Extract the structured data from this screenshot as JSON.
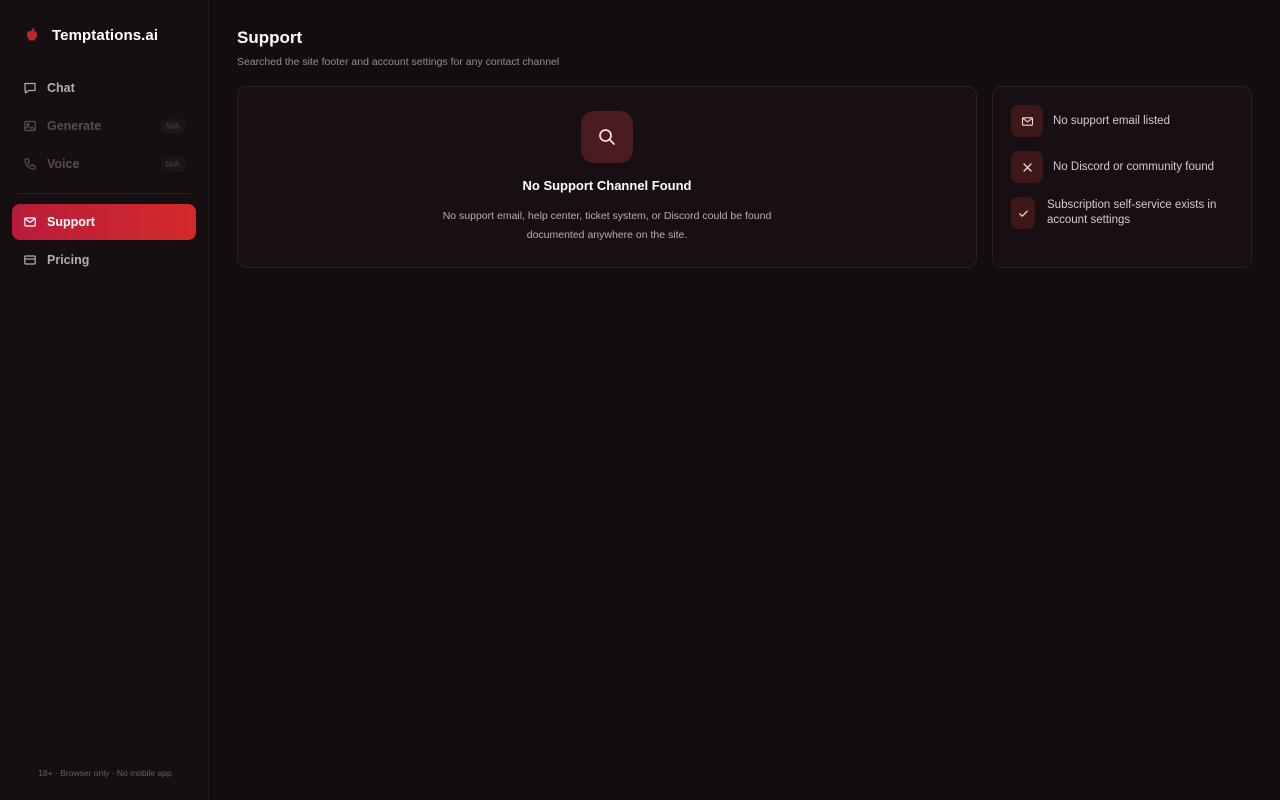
{
  "brand": {
    "name": "Temptations.ai",
    "accent": "#c0242f"
  },
  "sidebar": {
    "items": [
      {
        "label": "Chat",
        "icon": "chat-icon",
        "state": "normal"
      },
      {
        "label": "Generate",
        "icon": "image-icon",
        "state": "disabled",
        "tag": "N/A"
      },
      {
        "label": "Voice",
        "icon": "phone-icon",
        "state": "disabled",
        "tag": "N/A"
      },
      {
        "label": "Support",
        "icon": "mail-icon",
        "state": "active"
      },
      {
        "label": "Pricing",
        "icon": "card-icon",
        "state": "normal"
      }
    ],
    "footer": "18+ · Browser only · No mobile app"
  },
  "page": {
    "title": "Support",
    "subtitle": "Searched the site footer and account settings for any contact channel"
  },
  "main_card": {
    "icon": "search-icon",
    "title": "No Support Channel Found",
    "description": "No support email, help center, ticket system, or Discord could be found documented anywhere on the site."
  },
  "status_card": {
    "items": [
      {
        "icon": "mail-icon",
        "text": "No support email listed"
      },
      {
        "icon": "close-icon",
        "text": "No Discord or community found"
      },
      {
        "icon": "check-icon",
        "text": "Subscription self-service exists in account settings"
      }
    ]
  }
}
